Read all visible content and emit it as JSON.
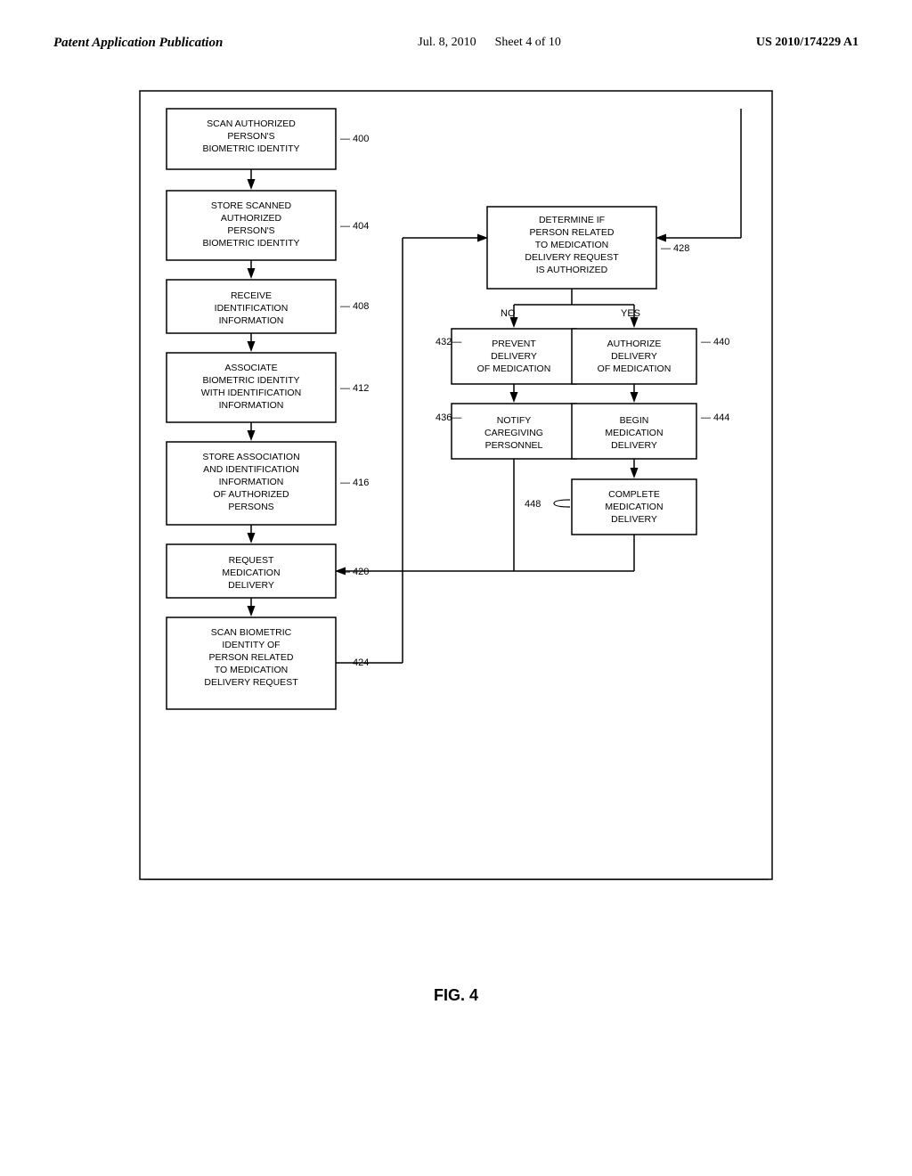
{
  "header": {
    "left": "Patent Application Publication",
    "center_date": "Jul. 8, 2010",
    "center_sheet": "Sheet 4 of 10",
    "right": "US 2010/174229 A1"
  },
  "figure": {
    "caption": "FIG. 4",
    "nodes": {
      "n400": {
        "label": "SCAN  AUTHORIZED\nPERSON'S\nBIOMETRIC  IDENTITY",
        "id": "400"
      },
      "n404": {
        "label": "STORE  SCANNED\nAUTHORIZED\nPERSON'S\nBIOMETRIC  IDENTITY",
        "id": "404"
      },
      "n408": {
        "label": "RECEIVE\nIDENTIFICATION\nINFORMATION",
        "id": "408"
      },
      "n412": {
        "label": "ASSOCIATE\nBIOMETRIC  IDENTITY\nWITH  IDENTIFICATION\nINFORMATION",
        "id": "412"
      },
      "n416": {
        "label": "STORE  ASSOCIATION\nAND  IDENTIFICATION\nINFORMATION\nOF  AUTHORIZED\nPERSONS",
        "id": "416"
      },
      "n420": {
        "label": "REQUEST\nMEDICATION\nDELIVERY",
        "id": "420"
      },
      "n424": {
        "label": "SCAN  BIOMETRIC\nIDENTITY  OF\nPERSON  RELATED\nTO  MEDICATION\nDELIVERY  REQUEST",
        "id": "424"
      },
      "n428": {
        "label": "DETERMINE  IF\nPERSON  RELATED\nTO  MEDICATION\nDELIVERY  REQUEST\nIS  AUTHORIZED",
        "id": "428"
      },
      "n432": {
        "label": "PREVENT\nDELIVERY\nOF  MEDICATION",
        "id": "432"
      },
      "n436": {
        "label": "NOTIFY\nCAREGIVING\nPERSONNEL",
        "id": "436"
      },
      "n440": {
        "label": "AUTHORIZE\nDELIVERY\nOF  MEDICATION",
        "id": "440"
      },
      "n444": {
        "label": "BEGIN\nMEDICATION\nDELIVERY",
        "id": "444"
      },
      "n448": {
        "label": "COMPLETE\nMEDICATION\nDELIVERY",
        "id": "448"
      }
    },
    "branch_labels": {
      "no": "NO",
      "yes": "YES"
    }
  }
}
